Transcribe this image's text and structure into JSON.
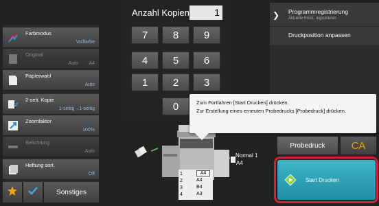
{
  "keypad": {
    "title": "Anzahl Kopien",
    "count": "1",
    "keys": [
      "7",
      "8",
      "9",
      "4",
      "5",
      "6",
      "1",
      "2",
      "3",
      "0"
    ]
  },
  "left_menu": [
    {
      "label": "Farbmodus",
      "value": "Vollfarbe",
      "enabled": true
    },
    {
      "label": "Original",
      "value": "A4",
      "value2": "Auto",
      "enabled": false
    },
    {
      "label": "Papierwahl",
      "value": "Auto",
      "enabled": true
    },
    {
      "label": "2-seit. Kopie",
      "value": "1-seitig→1-seitig",
      "enabled": true
    },
    {
      "label": "Zoomfaktor",
      "value": "100%",
      "enabled": true
    },
    {
      "label": "Belichtung",
      "value": "Auto",
      "enabled": false
    },
    {
      "label": "Heftung sort.",
      "value": "Off",
      "enabled": true
    }
  ],
  "bottom_bar": {
    "other_label": "Sonstiges"
  },
  "right_menu": {
    "program_register": "Programmregistrierung",
    "program_register_sub": "Aktuelle Einst. registrieren",
    "print_position": "Druckposition anpassen"
  },
  "tooltip": {
    "line1": "Zum Fortfahren [Start Drucken] drücken.",
    "line2": "Zur Erstellung eines erneuten Probedrucks [Probedruck] drücken."
  },
  "output": {
    "mode": "Normal 1",
    "size": "A4"
  },
  "trays": [
    {
      "num": "1",
      "size": "A4"
    },
    {
      "num": "2",
      "size": "A4"
    },
    {
      "num": "3",
      "size": "B4"
    },
    {
      "num": "4",
      "size": "A3"
    }
  ],
  "buttons": {
    "proof_print": "Probedruck",
    "clear_all": "CA",
    "start_print": "Start Drucken"
  },
  "colors": {
    "accent": "#2aa5b8",
    "highlight_frame": "#d81e3a",
    "ca": "#f2a200",
    "value_text": "#9ab9da"
  }
}
